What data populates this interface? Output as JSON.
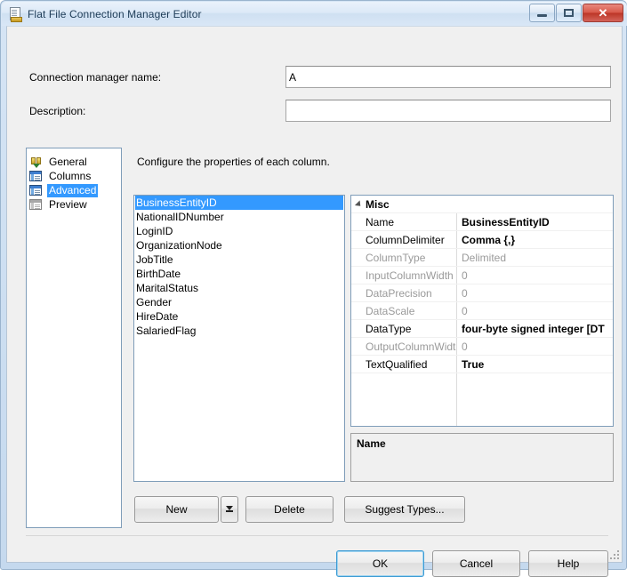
{
  "window": {
    "title": "Flat File Connection Manager Editor",
    "icon": "flat-file-icon",
    "controls": {
      "minimize": "minimize-icon",
      "maximize": "maximize-icon",
      "close": "✕"
    }
  },
  "header": {
    "connection_name_label": "Connection manager name:",
    "connection_name_value": "A",
    "connection_name_placeholder": "",
    "description_label": "Description:",
    "description_value": "",
    "description_placeholder": ""
  },
  "nav": {
    "items": [
      {
        "label": "General",
        "icon": "connection-plug-icon",
        "selected": false
      },
      {
        "label": "Columns",
        "icon": "columns-table-icon",
        "selected": false
      },
      {
        "label": "Advanced",
        "icon": "advanced-table-icon",
        "selected": true
      },
      {
        "label": "Preview",
        "icon": "preview-table-icon",
        "selected": false
      }
    ]
  },
  "main": {
    "instruction": "Configure the properties of each column.",
    "columns": [
      {
        "name": "BusinessEntityID",
        "selected": true
      },
      {
        "name": "NationalIDNumber",
        "selected": false
      },
      {
        "name": "LoginID",
        "selected": false
      },
      {
        "name": "OrganizationNode",
        "selected": false
      },
      {
        "name": "JobTitle",
        "selected": false
      },
      {
        "name": "BirthDate",
        "selected": false
      },
      {
        "name": "MaritalStatus",
        "selected": false
      },
      {
        "name": "Gender",
        "selected": false
      },
      {
        "name": "HireDate",
        "selected": false
      },
      {
        "name": "SalariedFlag",
        "selected": false
      }
    ],
    "property_grid": {
      "category": "Misc",
      "rows": [
        {
          "name": "Name",
          "value": "BusinessEntityID",
          "disabled": false
        },
        {
          "name": "ColumnDelimiter",
          "value": "Comma {,}",
          "disabled": false
        },
        {
          "name": "ColumnType",
          "value": "Delimited",
          "disabled": true
        },
        {
          "name": "InputColumnWidth",
          "value": "0",
          "disabled": true
        },
        {
          "name": "DataPrecision",
          "value": "0",
          "disabled": true
        },
        {
          "name": "DataScale",
          "value": "0",
          "disabled": true
        },
        {
          "name": "DataType",
          "value": "four-byte signed integer [DT",
          "disabled": false
        },
        {
          "name": "OutputColumnWidtl",
          "value": "0",
          "disabled": true
        },
        {
          "name": "TextQualified",
          "value": "True",
          "disabled": false
        }
      ]
    },
    "description_pane": {
      "title": "Name",
      "body": ""
    },
    "actions": {
      "new_label": "New",
      "new_dropdown_icon": "chevron-down-icon",
      "delete_label": "Delete",
      "suggest_types_label": "Suggest Types..."
    }
  },
  "footer": {
    "ok_label": "OK",
    "cancel_label": "Cancel",
    "help_label": "Help"
  },
  "colors": {
    "selection_blue": "#3399ff",
    "title_text": "#1e3c57",
    "close_red": "#bc3526",
    "disabled_gray": "#9a9a9a"
  }
}
